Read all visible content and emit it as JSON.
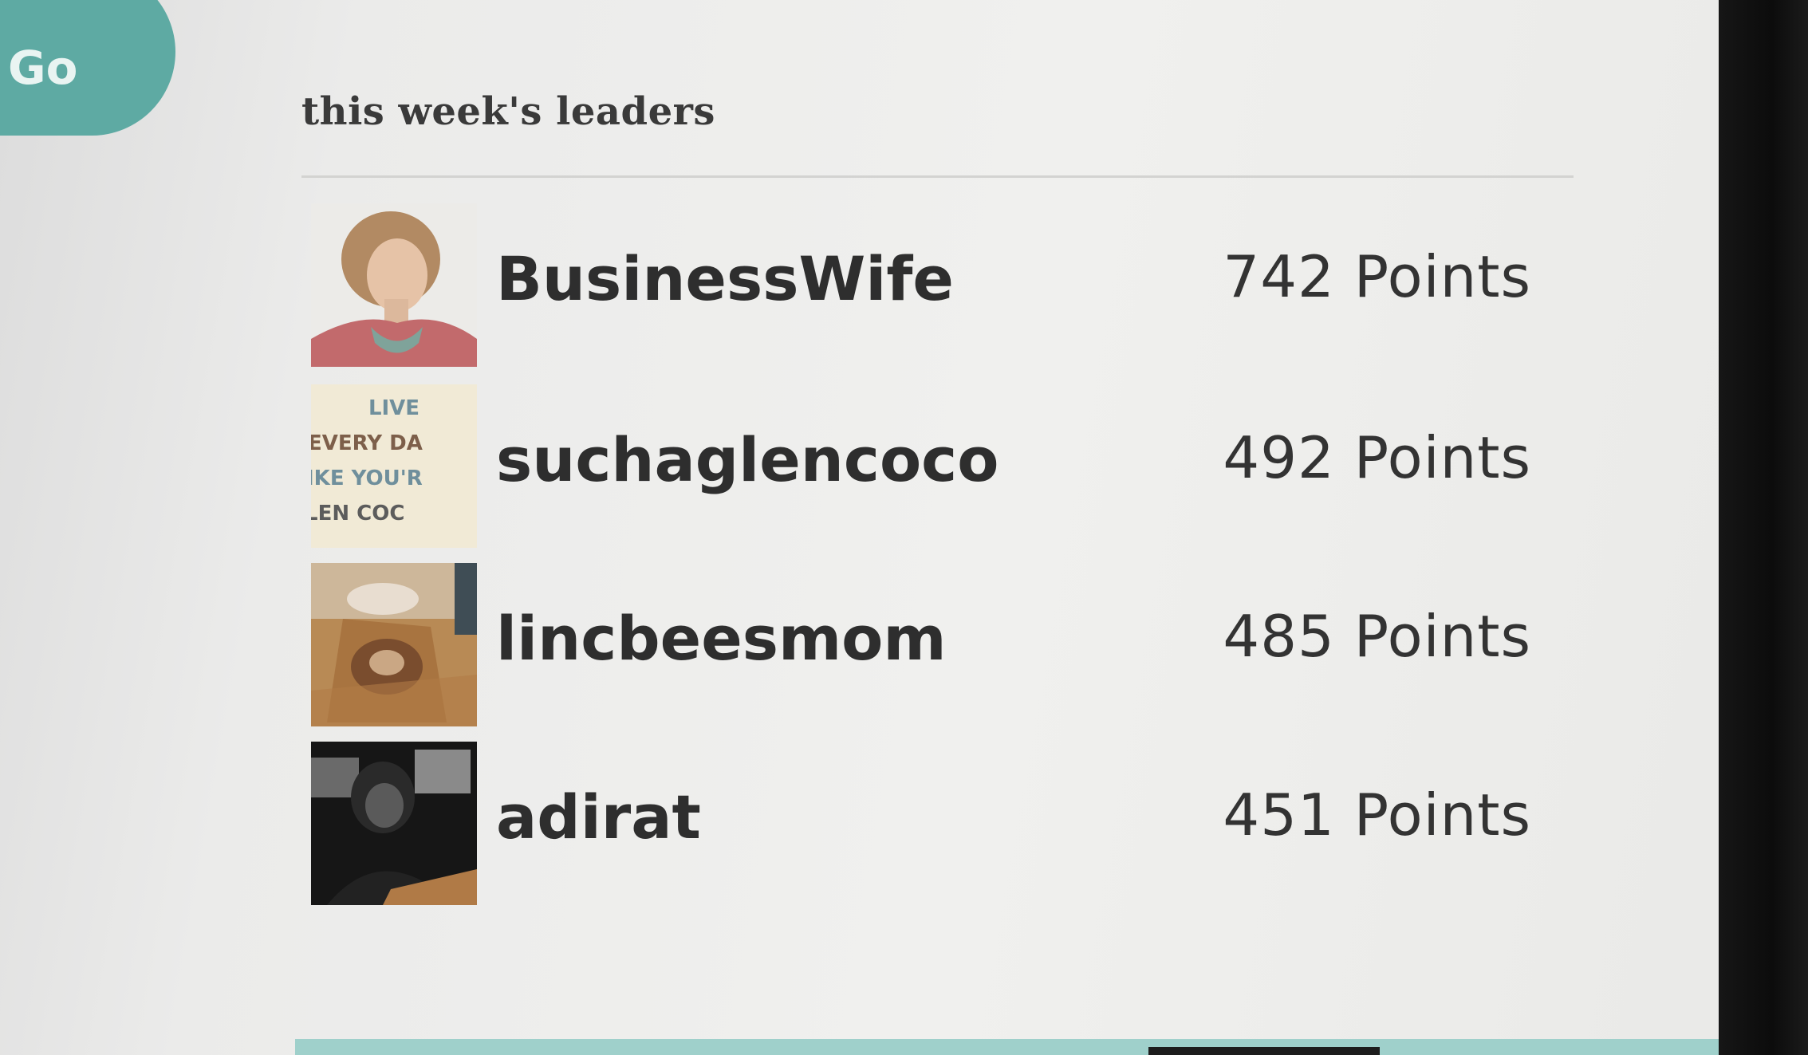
{
  "go_button": {
    "label": "Go"
  },
  "leaderboard": {
    "title": "this week's leaders",
    "leaders": [
      {
        "username": "BusinessWife",
        "points": "742 Points",
        "avatar_icon": "portrait-avatar"
      },
      {
        "username": "suchaglencoco",
        "points": "492 Points",
        "avatar_icon": "text-quote-avatar",
        "avatar_text": [
          "LIVE",
          "EVERY DA",
          "IKE YOU'R",
          "LEN COC"
        ]
      },
      {
        "username": "lincbeesmom",
        "points": "485 Points",
        "avatar_icon": "photo-avatar"
      },
      {
        "username": "adirat",
        "points": "451 Points",
        "avatar_icon": "dark-photo-avatar"
      }
    ]
  },
  "colors": {
    "accent": "#5eaaa3",
    "accent_light": "#9fd0cb",
    "text": "#2e2e2e"
  }
}
